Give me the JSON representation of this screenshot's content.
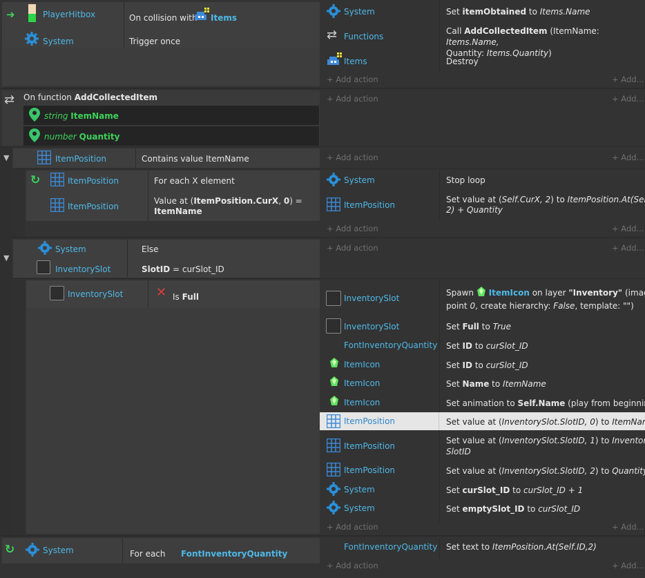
{
  "event1": {
    "conditions": [
      {
        "object": "PlayerHitbox",
        "text": "On collision with",
        "target": "Items"
      },
      {
        "object": "System",
        "text": "Trigger once"
      }
    ],
    "actions": [
      {
        "object": "System",
        "pre": "Set",
        "bold": "itemObtained",
        "mid": "to",
        "ital": "Items.Name"
      },
      {
        "object": "Functions",
        "line1_pre": "Call",
        "line1_bold": "AddCollectedItem",
        "line1_rest": "(ItemName:",
        "line1_ital": "Items.Name,",
        "line2_pre": "Quantity:",
        "line2_ital": "Items.Quantity",
        "line2_end": ")"
      },
      {
        "object": "Items",
        "text": "Destroy"
      }
    ]
  },
  "add_action": "Add action",
  "add_more": "Add...",
  "function": {
    "label": "On function",
    "name": "AddCollectedItem",
    "params": [
      {
        "type": "string",
        "name": "ItemName"
      },
      {
        "type": "number",
        "name": "Quantity"
      }
    ]
  },
  "sub1": {
    "object": "ItemPosition",
    "text": "Contains value ItemName"
  },
  "sub1a": {
    "conditions": [
      {
        "object": "ItemPosition",
        "text": "For each X element"
      },
      {
        "object": "ItemPosition",
        "l1_pre": "Value at (",
        "l1_bold": "ItemPosition.CurX",
        "l1_mid": ", ",
        "l1_bold2": "0",
        "l1_end": ") =",
        "l2_bold": "ItemName"
      }
    ],
    "actions": [
      {
        "object": "System",
        "text": "Stop loop"
      },
      {
        "object": "ItemPosition",
        "l1": "Set value at (",
        "l1_ital": "Self.CurX, 2",
        "l1_mid": ") to ",
        "l1_ital2": "ItemPosition.At(Self.CurX,",
        "l2_ital": "2)",
        "l2_rest": " + ",
        "l2_ital2": "Quantity"
      }
    ]
  },
  "else_event": {
    "conditions": [
      {
        "object": "System",
        "text": "Else"
      },
      {
        "object": "InventorySlot",
        "bold": "SlotID",
        "rest": " = curSlot_ID"
      }
    ]
  },
  "full_event": {
    "condition": {
      "object": "InventorySlot",
      "prefix": "Is",
      "bold": "Full"
    },
    "actions": [
      {
        "object": "InventorySlot",
        "l1_pre": "Spawn",
        "l1_obj": "ItemIcon",
        "l1_mid": "on layer",
        "l1_bold": "\"Inventory\"",
        "l1_end": "(image",
        "l2_pre": "point",
        "l2_i1": "0",
        "l2_mid": ", create hierarchy:",
        "l2_i2": "False",
        "l2_end": ", template: \"\")"
      },
      {
        "object": "InventorySlot",
        "pre": "Set",
        "bold": "Full",
        "mid": "to",
        "ital": "True"
      },
      {
        "object": "FontInventoryQuantity",
        "pre": "Set",
        "bold": "ID",
        "mid": "to",
        "ital": "curSlot_ID"
      },
      {
        "object": "ItemIcon",
        "pre": "Set",
        "bold": "ID",
        "mid": "to",
        "ital": "curSlot_ID"
      },
      {
        "object": "ItemIcon",
        "pre": "Set",
        "bold": "Name",
        "mid": "to",
        "ital": "ItemName"
      },
      {
        "object": "ItemIcon",
        "pre": "Set animation to",
        "bold": "Self.Name",
        "mid": "(play from beginning)"
      },
      {
        "object": "ItemPosition",
        "pre": "Set value at (",
        "ital": "InventorySlot.SlotID, 0",
        "mid": ") to",
        "ital2": "ItemName"
      },
      {
        "object": "ItemPosition",
        "pre": "Set value at (",
        "ital": "InventorySlot.SlotID, 1",
        "mid": ") to",
        "ital2": "InventorySlot.",
        "l2_ital": "SlotID"
      },
      {
        "object": "ItemPosition",
        "pre": "Set value at (",
        "ital": "InventorySlot.SlotID, 2",
        "mid": ") to",
        "ital2": "Quantity"
      },
      {
        "object": "System",
        "pre": "Set",
        "bold": "curSlot_ID",
        "mid": "to",
        "ital": "curSlot_ID + 1"
      },
      {
        "object": "System",
        "pre": "Set",
        "bold": "emptySlot_ID",
        "mid": "to",
        "ital": "curSlot_ID"
      }
    ]
  },
  "foreach_event": {
    "condition": {
      "object": "System",
      "text": "For each",
      "target": "FontInventoryQuantity"
    },
    "action": {
      "object": "FontInventoryQuantity",
      "pre": "Set text to",
      "ital": "ItemPosition.At(Self.ID,2)"
    }
  }
}
